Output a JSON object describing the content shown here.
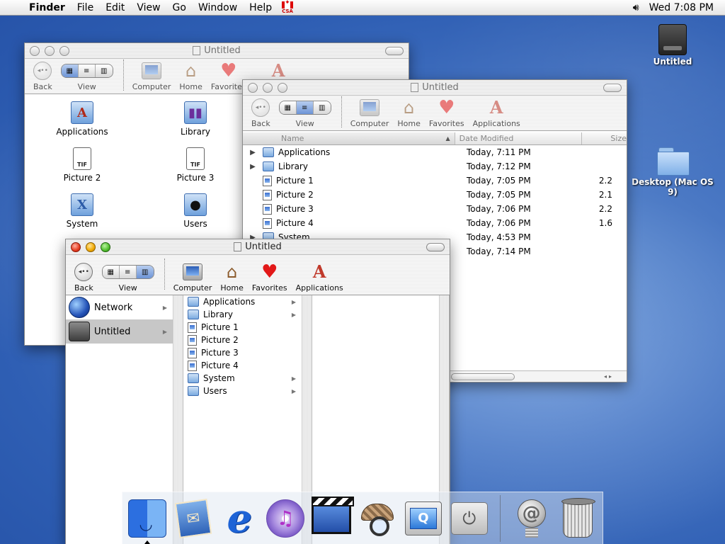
{
  "menubar": {
    "items": [
      "Finder",
      "File",
      "Edit",
      "View",
      "Go",
      "Window",
      "Help"
    ],
    "flag_label": "CSA",
    "clock": "Wed 7:08 PM"
  },
  "desktop": {
    "icons": [
      {
        "label": "Untitled",
        "icon": "hard-drive-icon"
      },
      {
        "label": "Desktop (Mac OS 9)",
        "icon": "folder-icon"
      }
    ]
  },
  "toolbar": {
    "back": "Back",
    "view": "View",
    "computer": "Computer",
    "home": "Home",
    "favorites": "Favorites",
    "applications": "Applications"
  },
  "window_icon": {
    "title": "Untitled",
    "items": [
      {
        "label": "Applications",
        "icon": "applications-folder-icon"
      },
      {
        "label": "Library",
        "icon": "library-folder-icon"
      },
      {
        "label": "Picture 2",
        "icon": "tif-file-icon"
      },
      {
        "label": "Picture 3",
        "icon": "tif-file-icon"
      },
      {
        "label": "System",
        "icon": "system-folder-icon"
      },
      {
        "label": "Users",
        "icon": "users-folder-icon"
      }
    ],
    "tif_label": "TIF"
  },
  "window_list": {
    "title": "Untitled",
    "columns": {
      "name": "Name",
      "date": "Date Modified",
      "size": "Size"
    },
    "rows": [
      {
        "name": "Applications",
        "date": "Today, 7:11 PM",
        "size": "",
        "folder": true
      },
      {
        "name": "Library",
        "date": "Today, 7:12 PM",
        "size": "",
        "folder": true
      },
      {
        "name": "Picture 1",
        "date": "Today, 7:05 PM",
        "size": "2.2",
        "folder": false
      },
      {
        "name": "Picture 2",
        "date": "Today, 7:05 PM",
        "size": "2.1",
        "folder": false
      },
      {
        "name": "Picture 3",
        "date": "Today, 7:06 PM",
        "size": "2.2",
        "folder": false
      },
      {
        "name": "Picture 4",
        "date": "Today, 7:06 PM",
        "size": "1.6",
        "folder": false
      },
      {
        "name": "System",
        "date": "Today, 4:53 PM",
        "size": "",
        "folder": true
      },
      {
        "name": "Users",
        "date": "Today, 7:14 PM",
        "size": "",
        "folder": true
      }
    ]
  },
  "window_column": {
    "title": "Untitled",
    "col1": [
      {
        "label": "Network",
        "selected": false
      },
      {
        "label": "Untitled",
        "selected": true
      }
    ],
    "col2": [
      {
        "label": "Applications",
        "folder": true
      },
      {
        "label": "Library",
        "folder": true
      },
      {
        "label": "Picture 1",
        "folder": false
      },
      {
        "label": "Picture 2",
        "folder": false
      },
      {
        "label": "Picture 3",
        "folder": false
      },
      {
        "label": "Picture 4",
        "folder": false
      },
      {
        "label": "System",
        "folder": true
      },
      {
        "label": "Users",
        "folder": true
      }
    ]
  },
  "dock": {
    "apps": [
      "finder-icon",
      "mail-icon",
      "internet-explorer-icon",
      "itunes-icon",
      "imovie-icon",
      "sherlock-icon",
      "quicktime-icon",
      "system-preferences-icon"
    ],
    "docs": [
      "mail-at-icon",
      "trash-icon"
    ]
  }
}
